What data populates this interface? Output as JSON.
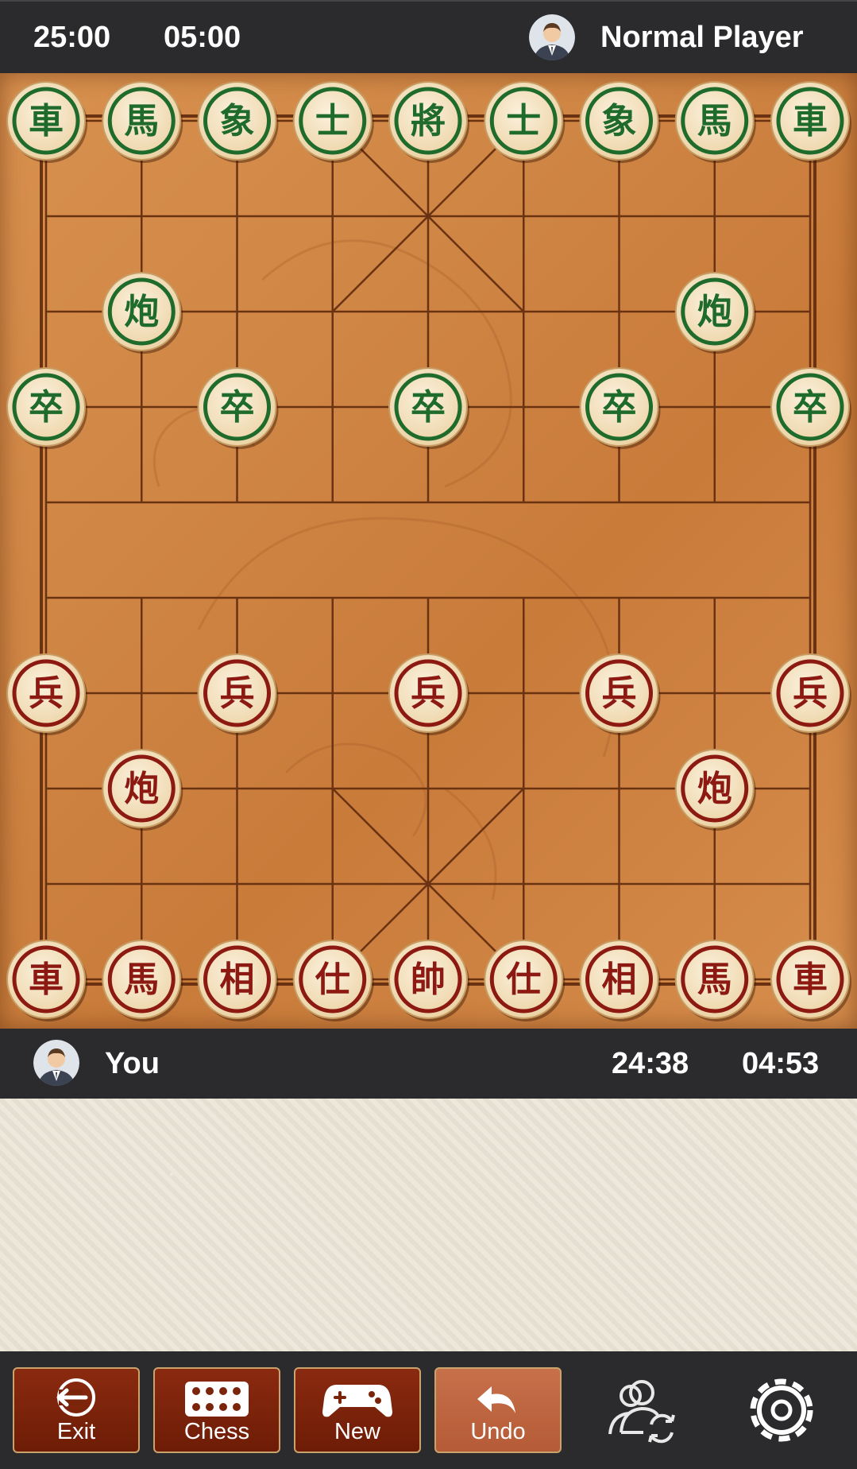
{
  "top_bar": {
    "opponent_total_time": "25:00",
    "opponent_move_time": "05:00",
    "opponent_name": "Normal Player"
  },
  "bottom_bar": {
    "player_name": "You",
    "player_total_time": "24:38",
    "player_move_time": "04:53"
  },
  "board": {
    "pieces": [
      {
        "char": "車",
        "side": "green",
        "file": 0,
        "rank": 0
      },
      {
        "char": "馬",
        "side": "green",
        "file": 1,
        "rank": 0
      },
      {
        "char": "象",
        "side": "green",
        "file": 2,
        "rank": 0
      },
      {
        "char": "士",
        "side": "green",
        "file": 3,
        "rank": 0
      },
      {
        "char": "將",
        "side": "green",
        "file": 4,
        "rank": 0
      },
      {
        "char": "士",
        "side": "green",
        "file": 5,
        "rank": 0
      },
      {
        "char": "象",
        "side": "green",
        "file": 6,
        "rank": 0
      },
      {
        "char": "馬",
        "side": "green",
        "file": 7,
        "rank": 0
      },
      {
        "char": "車",
        "side": "green",
        "file": 8,
        "rank": 0
      },
      {
        "char": "炮",
        "side": "green",
        "file": 1,
        "rank": 2
      },
      {
        "char": "炮",
        "side": "green",
        "file": 7,
        "rank": 2
      },
      {
        "char": "卒",
        "side": "green",
        "file": 0,
        "rank": 3
      },
      {
        "char": "卒",
        "side": "green",
        "file": 2,
        "rank": 3
      },
      {
        "char": "卒",
        "side": "green",
        "file": 4,
        "rank": 3
      },
      {
        "char": "卒",
        "side": "green",
        "file": 6,
        "rank": 3
      },
      {
        "char": "卒",
        "side": "green",
        "file": 8,
        "rank": 3
      },
      {
        "char": "兵",
        "side": "red",
        "file": 0,
        "rank": 6
      },
      {
        "char": "兵",
        "side": "red",
        "file": 2,
        "rank": 6
      },
      {
        "char": "兵",
        "side": "red",
        "file": 4,
        "rank": 6
      },
      {
        "char": "兵",
        "side": "red",
        "file": 6,
        "rank": 6
      },
      {
        "char": "兵",
        "side": "red",
        "file": 8,
        "rank": 6
      },
      {
        "char": "炮",
        "side": "red",
        "file": 1,
        "rank": 7
      },
      {
        "char": "炮",
        "side": "red",
        "file": 7,
        "rank": 7
      },
      {
        "char": "車",
        "side": "red",
        "file": 0,
        "rank": 9
      },
      {
        "char": "馬",
        "side": "red",
        "file": 1,
        "rank": 9
      },
      {
        "char": "相",
        "side": "red",
        "file": 2,
        "rank": 9
      },
      {
        "char": "仕",
        "side": "red",
        "file": 3,
        "rank": 9
      },
      {
        "char": "帥",
        "side": "red",
        "file": 4,
        "rank": 9
      },
      {
        "char": "仕",
        "side": "red",
        "file": 5,
        "rank": 9
      },
      {
        "char": "相",
        "side": "red",
        "file": 6,
        "rank": 9
      },
      {
        "char": "馬",
        "side": "red",
        "file": 7,
        "rank": 9
      },
      {
        "char": "車",
        "side": "red",
        "file": 8,
        "rank": 9
      }
    ]
  },
  "toolbar": {
    "exit_label": "Exit",
    "chess_label": "Chess",
    "new_label": "New",
    "undo_label": "Undo",
    "icons": [
      "exit-icon",
      "chess-board-icon",
      "gamepad-icon",
      "undo-icon",
      "players-swap-icon",
      "gear-icon"
    ]
  },
  "colors": {
    "bar_bg": "#2b2b2d",
    "green_piece": "#1f6b2c",
    "red_piece": "#8c1a12",
    "piece_face": "#f6e3c0",
    "button_bg": "#7a2409",
    "button_active_bg": "#bd6440",
    "button_border": "#c9a36b"
  }
}
